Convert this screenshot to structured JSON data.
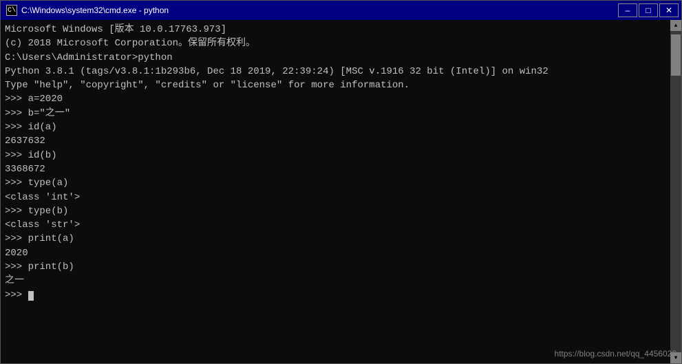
{
  "titleBar": {
    "icon": "C:\\",
    "title": "C:\\Windows\\system32\\cmd.exe - python",
    "minimizeLabel": "–",
    "maximizeLabel": "□",
    "closeLabel": "✕"
  },
  "console": {
    "lines": [
      {
        "text": "Microsoft Windows [版本 10.0.17763.973]",
        "color": "white"
      },
      {
        "text": "(c) 2018 Microsoft Corporation。保留所有权利。",
        "color": "white"
      },
      {
        "text": "",
        "color": "white"
      },
      {
        "text": "C:\\Users\\Administrator>python",
        "color": "white"
      },
      {
        "text": "Python 3.8.1 (tags/v3.8.1:1b293b6, Dec 18 2019, 22:39:24) [MSC v.1916 32 bit (Intel)] on win32",
        "color": "white"
      },
      {
        "text": "Type \"help\", \"copyright\", \"credits\" or \"license\" for more information.",
        "color": "white"
      },
      {
        "text": ">>> a=2020",
        "color": "white"
      },
      {
        "text": ">>> b=\"之一\"",
        "color": "white"
      },
      {
        "text": ">>> id(a)",
        "color": "white"
      },
      {
        "text": "2637632",
        "color": "white"
      },
      {
        "text": ">>> id(b)",
        "color": "white"
      },
      {
        "text": "3368672",
        "color": "white"
      },
      {
        "text": ">>> type(a)",
        "color": "white"
      },
      {
        "text": "<class 'int'>",
        "color": "white"
      },
      {
        "text": ">>> type(b)",
        "color": "white"
      },
      {
        "text": "<class 'str'>",
        "color": "white"
      },
      {
        "text": ">>> print(a)",
        "color": "white"
      },
      {
        "text": "2020",
        "color": "white"
      },
      {
        "text": ">>> print(b)",
        "color": "white"
      },
      {
        "text": "之一",
        "color": "white"
      },
      {
        "text": ">>> ",
        "color": "white",
        "cursor": true
      }
    ]
  },
  "watermark": {
    "text": "https://blog.csdn.net/qq_4456029"
  }
}
